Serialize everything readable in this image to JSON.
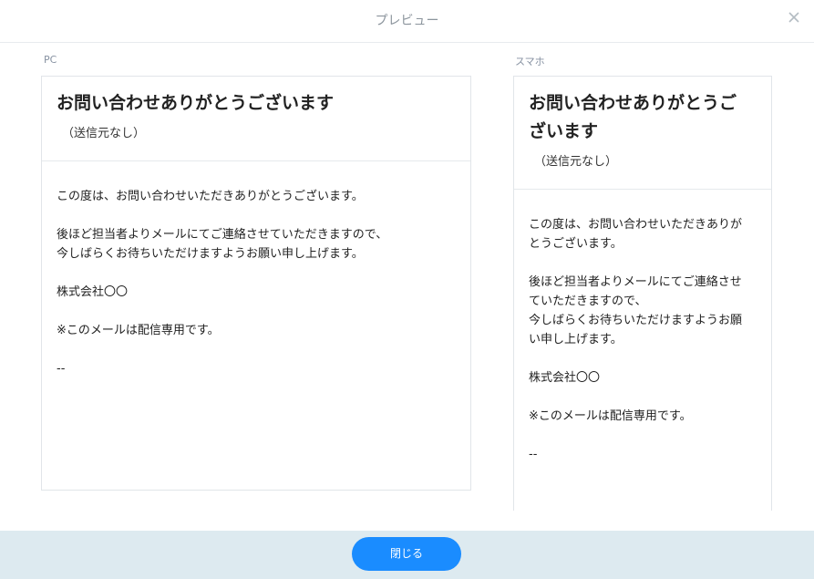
{
  "modal": {
    "title": "プレビュー",
    "close_icon": "close-icon",
    "footer_close_label": "閉じる"
  },
  "pc": {
    "label": "PC",
    "subject": "お問い合わせありがとうございます",
    "sender": "（送信元なし）",
    "body_lines": [
      "この度は、お問い合わせいただきありがとうございます。",
      "",
      "後ほど担当者よりメールにてご連絡させていただきますので、",
      "今しばらくお待ちいただけますようお願い申し上げます。",
      "",
      "株式会社〇〇",
      "",
      "※このメールは配信専用です。",
      "",
      "--"
    ]
  },
  "sp": {
    "label": "スマホ",
    "subject_lines": [
      "お問い合わせありがとうご",
      "ざいます"
    ],
    "sender": "（送信元なし）",
    "body_lines": [
      "この度は、お問い合わせいただきありが",
      "とうございます。",
      "",
      "後ほど担当者よりメールにてご連絡させ",
      "ていただきますので、",
      "今しばらくお待ちいただけますようお願",
      "い申し上げます。",
      "",
      "株式会社〇〇",
      "",
      "※このメールは配信専用です。",
      "",
      "--"
    ]
  },
  "colors": {
    "accent": "#1a8cff",
    "footer_bg": "#ddeaf0",
    "label": "#8792a2"
  }
}
